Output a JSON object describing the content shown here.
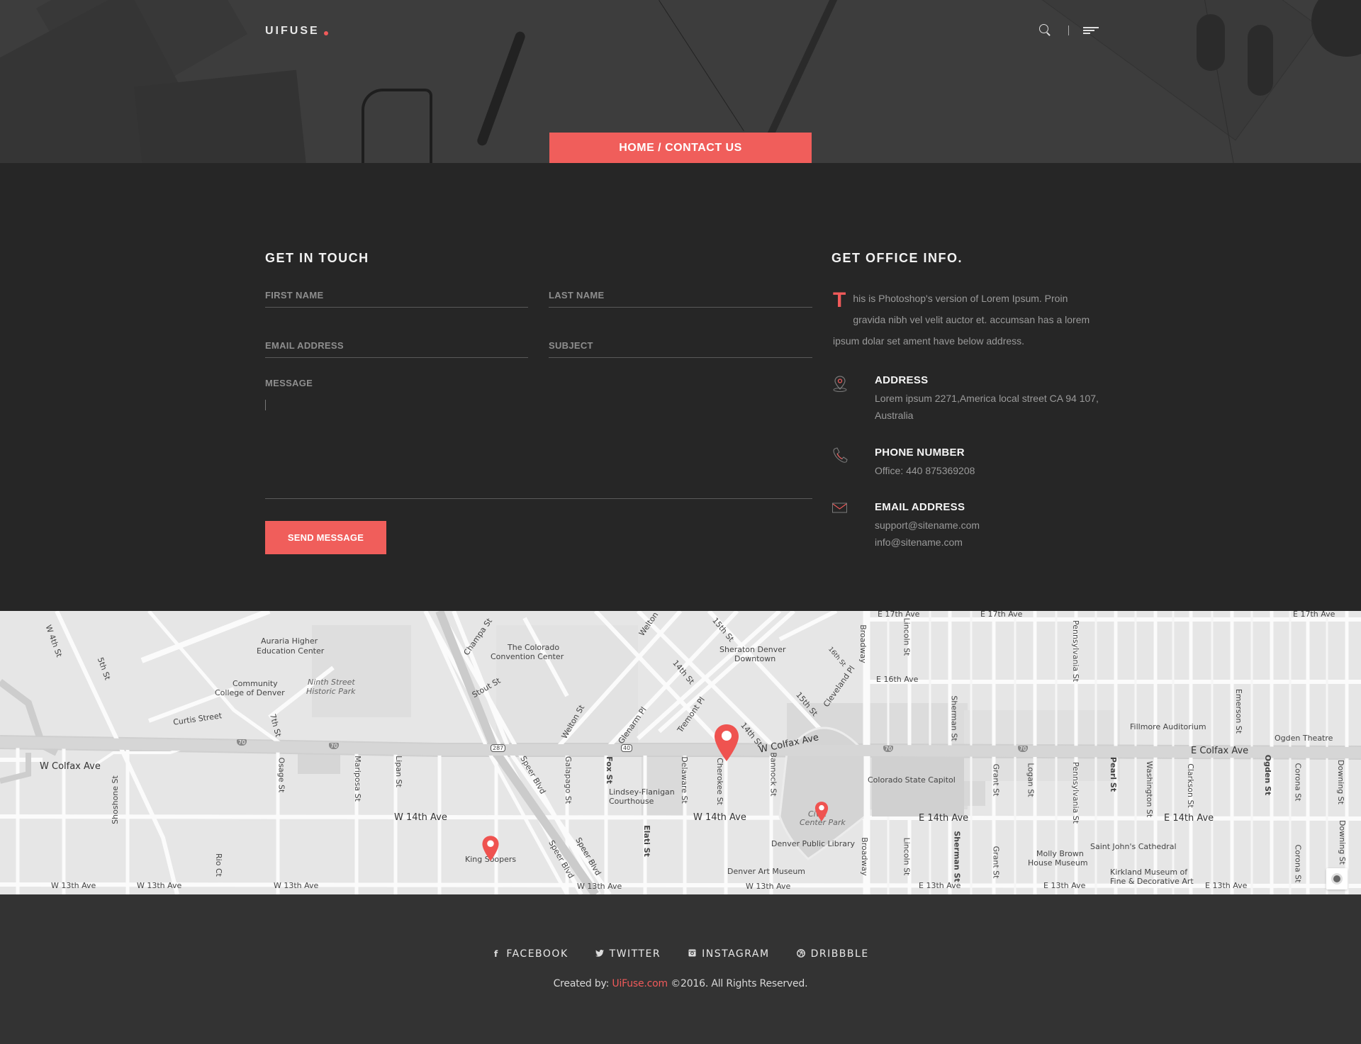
{
  "header": {
    "logo": "UIFUSE",
    "accent_color": "#f05a5a",
    "icons": [
      "search-icon",
      "menu-icon"
    ],
    "breadcrumb": "HOME / CONTACT US"
  },
  "contact_form": {
    "title": "GET IN TOUCH",
    "fields": {
      "first_name": {
        "placeholder": "FIRST NAME",
        "value": ""
      },
      "last_name": {
        "placeholder": "LAST NAME",
        "value": ""
      },
      "email": {
        "placeholder": "EMAIL ADDRESS",
        "value": ""
      },
      "subject": {
        "placeholder": "SUBJECT",
        "value": ""
      },
      "message": {
        "placeholder": "MESSAGE",
        "value": ""
      }
    },
    "submit_label": "SEND MESSAGE"
  },
  "office_info": {
    "title": "GET OFFICE INFO.",
    "intro_dropcap": "T",
    "intro_rest": "his is Photoshop's version  of Lorem Ipsum. Proin gravida nibh vel velit auctor et. accumsan has a lorem ipsum dolar set ament  have below  address.",
    "items": [
      {
        "icon": "map-pin-icon",
        "heading": "ADDRESS",
        "lines": [
          "Lorem ipsum 2271,America local street CA 94 107, Australia"
        ]
      },
      {
        "icon": "phone-icon",
        "heading": "PHONE NUMBER",
        "lines": [
          "Office: 440 875369208"
        ]
      },
      {
        "icon": "envelope-icon",
        "heading": "EMAIL ADDRESS",
        "lines": [
          "support@sitename.com",
          "info@sitename.com"
        ]
      }
    ]
  },
  "map": {
    "labels": {
      "auraria": "Auraria Higher",
      "auraria2": "Education Center",
      "ccd1": "Community",
      "ccd2": "College of Denver",
      "ninth1": "Ninth Street",
      "ninth2": "Historic Park",
      "curtis": "Curtis Street",
      "w4th": "W 4th St",
      "fifth": "5th St",
      "seventh": "7th St",
      "wcolfax_w": "W Colfax Ave",
      "shoshone": "Shoshone St",
      "osage": "Osage St",
      "mariposa": "Mariposa St",
      "lipan": "Lipan St",
      "rioct": "Rio Ct",
      "w14th_w": "W 14th Ave",
      "w13th_1": "W 13th Ave",
      "w13th_2": "W 13th Ave",
      "w13th_3": "W 13th Ave",
      "w13th_4": "W 13th Ave",
      "w13th_5": "W 13th Ave",
      "conv1": "The Colorado",
      "conv2": "Convention Center",
      "champa": "Champa St",
      "stout": "Stout St",
      "welton": "Welton St",
      "welton2": "Welton",
      "glenarm": "Glenarm Pl",
      "tremont": "Tremont Pl",
      "fourteenth": "14th St",
      "fourteenth2": "14th St",
      "fifteenth": "15th St",
      "fifteenth2": "15th St",
      "sixteenth": "16th St",
      "cleveland": "Cleveland Pl",
      "sheraton1": "Sheraton Denver",
      "sheraton2": "Downtown",
      "wcolfax": "W Colfax Ave",
      "speer1": "Speer Blvd",
      "speer2": "Speer Blvd",
      "speer3": "Speer Blvd",
      "galapago": "Galapago St",
      "fox": "Fox St",
      "lindsey1": "Lindsey-Flanigan",
      "lindsey2": "Courthouse",
      "delaware": "Delaware St",
      "cherokee": "Cherokee St",
      "bannock": "Bannock St",
      "elati": "Elati St",
      "w14th": "W 14th Ave",
      "kingsoopers": "King Soopers",
      "civic1": "Civic",
      "civic2": "Center Park",
      "library": "Denver Public Library",
      "artmuseum": "Denver Art Museum",
      "broadway": "Broadway",
      "broadway2": "Broadway",
      "lincoln": "Lincoln St",
      "lincoln2": "Lincoln St",
      "e16th": "E 16th Ave",
      "sherman": "Sherman St",
      "sherman2": "Sherman St",
      "capitol": "Colorado State Capitol",
      "grant": "Grant St",
      "grant2": "Grant St",
      "logan": "Logan St",
      "penn": "Pennsylvania St",
      "penn2": "Pennsylvania St",
      "pearl": "Pearl St",
      "washington": "Washington St",
      "clarkson": "Clarkson St",
      "emerson": "Emerson St",
      "ogden": "Ogden St",
      "corona": "Corona St",
      "corona2": "Corona St",
      "downing": "Downing St",
      "downing2": "Downing St",
      "fillmore": "Fillmore Auditorium",
      "ogdentheatre": "Ogden Theatre",
      "ecolfax": "E Colfax Ave",
      "e14th_1": "E 14th Ave",
      "e14th_2": "E 14th Ave",
      "e13th_1": "E 13th Ave",
      "e13th_2": "E 13th Ave",
      "e13th_3": "E 13th Ave",
      "stjohns": "Saint John's Cathedral",
      "molly1": "Molly Brown",
      "molly2": "House Museum",
      "kirkland1": "Kirkland Museum of",
      "kirkland2": "Fine & Decorative Art",
      "e17th_1": "E 17th Ave",
      "e17th_2": "E 17th Ave",
      "e17th_3": "E 17th Ave",
      "i70": "70",
      "us287": "287",
      "us40": "40"
    },
    "pin_color": "#ef5350"
  },
  "footer": {
    "social": [
      {
        "icon": "facebook-icon",
        "glyph": "f",
        "label": "FACEBOOK"
      },
      {
        "icon": "twitter-icon",
        "glyph": "♥",
        "label": "TWITTER"
      },
      {
        "icon": "instagram-icon",
        "glyph": "◙",
        "label": "INSTAGRAM"
      },
      {
        "icon": "dribbble-icon",
        "glyph": "⊛",
        "label": "DRIBBBLE"
      }
    ],
    "copyright_prefix": "Created by: ",
    "copyright_brand": "UiFuse.com",
    "copyright_suffix": " ©2016. All Rights Reserved."
  }
}
